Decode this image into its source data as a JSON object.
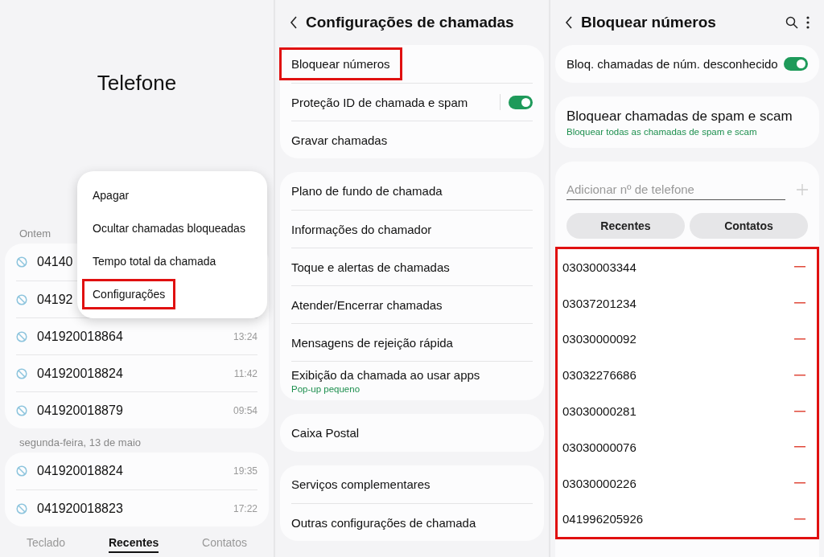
{
  "phone": {
    "title": "Telefone",
    "groups": [
      {
        "label": "Ontem",
        "calls": [
          {
            "number": "04140"
          },
          {
            "number": "04192"
          },
          {
            "number": "041920018864",
            "time": "13:24"
          },
          {
            "number": "041920018824",
            "time": "11:42"
          },
          {
            "number": "041920018879",
            "time": "09:54"
          }
        ]
      },
      {
        "label": "segunda-feira, 13 de maio",
        "calls": [
          {
            "number": "041920018824",
            "time": "19:35"
          },
          {
            "number": "041920018823",
            "time": "17:22"
          }
        ]
      }
    ],
    "menu": [
      {
        "label": "Apagar",
        "highlighted": false
      },
      {
        "label": "Ocultar chamadas bloqueadas",
        "highlighted": false
      },
      {
        "label": "Tempo total da chamada",
        "highlighted": false
      },
      {
        "label": "Configurações",
        "highlighted": true
      }
    ],
    "tabs": [
      {
        "label": "Teclado",
        "selected": false
      },
      {
        "label": "Recentes",
        "selected": true
      },
      {
        "label": "Contatos",
        "selected": false
      }
    ]
  },
  "call_settings": {
    "title": "Configurações de chamadas",
    "cards": [
      [
        {
          "label": "Bloquear números",
          "highlighted": true
        },
        {
          "label": "Proteção ID de chamada e spam",
          "on": true
        },
        {
          "label": "Gravar chamadas"
        }
      ],
      [
        {
          "label": "Plano de fundo de chamada"
        },
        {
          "label": "Informações do chamador"
        },
        {
          "label": "Toque e alertas de chamadas"
        },
        {
          "label": "Atender/Encerrar chamadas"
        },
        {
          "label": "Mensagens de rejeição rápida"
        },
        {
          "label": "Exibição da chamada ao usar apps",
          "subtitle": "Pop-up pequeno"
        }
      ],
      [
        {
          "label": "Caixa Postal"
        }
      ],
      [
        {
          "label": "Serviços complementares"
        },
        {
          "label": "Outras configurações de chamada"
        }
      ]
    ]
  },
  "block_numbers": {
    "title": "Bloquear números",
    "unknown": {
      "label": "Bloq. chamadas de núm. desconhecido",
      "on": true
    },
    "spam": {
      "label": "Bloquear chamadas de spam e scam",
      "subtitle": "Bloquear todas as chamadas de spam e scam"
    },
    "add_field": {
      "placeholder": "Adicionar nº de telefone"
    },
    "buttons": [
      "Recentes",
      "Contatos"
    ],
    "list_highlighted": true,
    "numbers": [
      "03030003344",
      "03037201234",
      "03030000092",
      "03032276686",
      "03030000281",
      "03030000076",
      "03030000226",
      "041996205926"
    ]
  }
}
